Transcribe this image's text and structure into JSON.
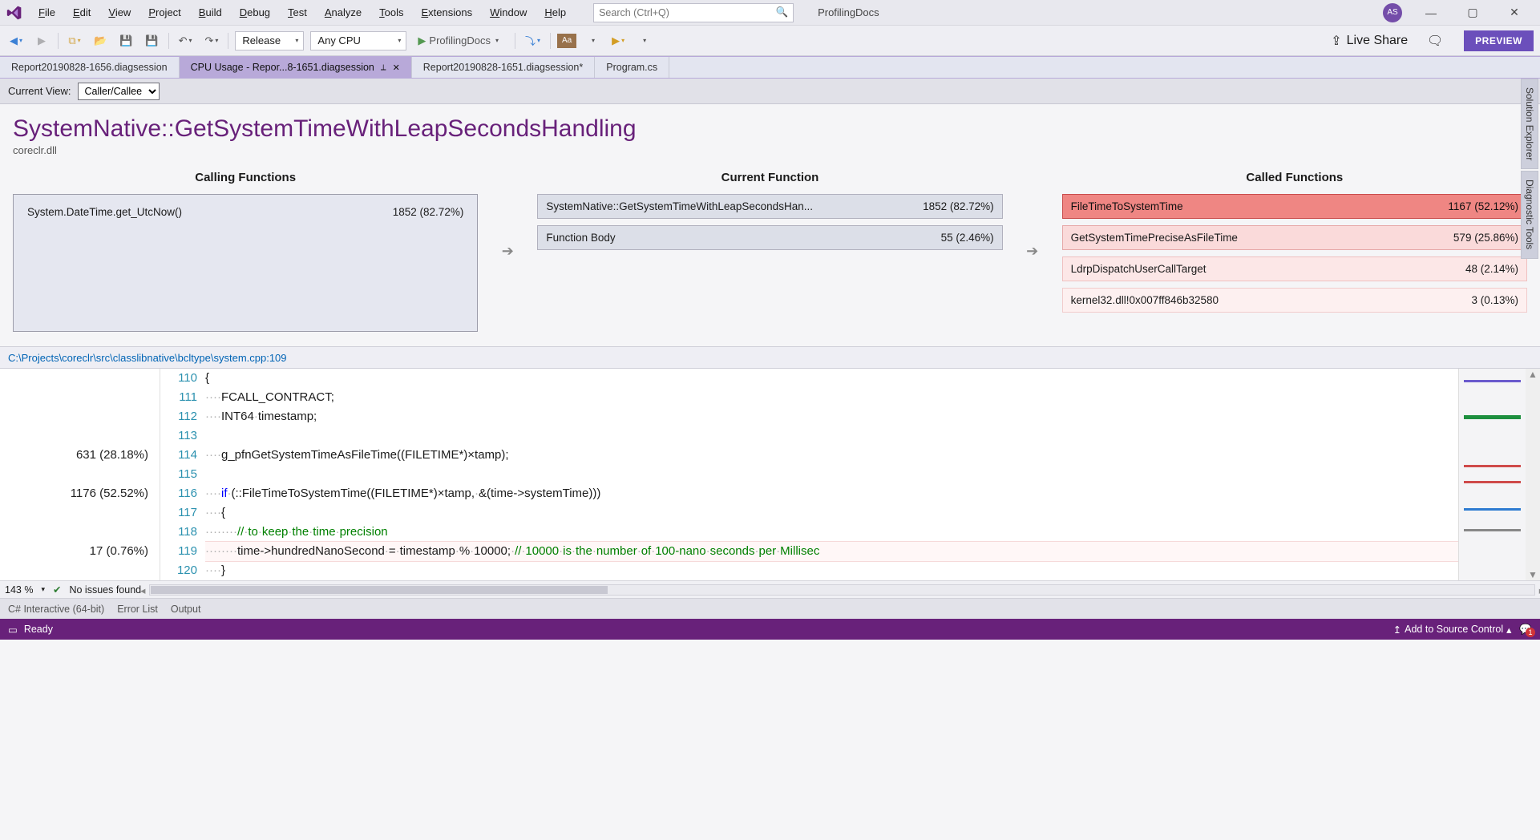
{
  "title_bar": {
    "solution_name": "ProfilingDocs",
    "search_placeholder": "Search (Ctrl+Q)",
    "user_initials": "AS",
    "menus": [
      "File",
      "Edit",
      "View",
      "Project",
      "Build",
      "Debug",
      "Test",
      "Analyze",
      "Tools",
      "Extensions",
      "Window",
      "Help"
    ]
  },
  "toolbar": {
    "config": "Release",
    "platform": "Any CPU",
    "run_target": "ProfilingDocs",
    "live_share": "Live Share",
    "preview": "PREVIEW"
  },
  "doc_tabs": [
    {
      "label": "Report20190828-1656.diagsession",
      "active": false
    },
    {
      "label": "CPU Usage - Repor...8-1651.diagsession",
      "active": true,
      "pinned": true,
      "close": true
    },
    {
      "label": "Report20190828-1651.diagsession*",
      "active": false
    },
    {
      "label": "Program.cs",
      "active": false
    }
  ],
  "side_tabs": [
    "Solution Explorer",
    "Diagnostic Tools"
  ],
  "profiler": {
    "view_label": "Current View:",
    "view_value": "Caller/Callee",
    "function_name": "SystemNative::GetSystemTimeWithLeapSecondsHandling",
    "module": "coreclr.dll",
    "columns": {
      "calling": "Calling Functions",
      "current": "Current Function",
      "called": "Called Functions"
    },
    "calling": [
      {
        "name": "System.DateTime.get_UtcNow()",
        "metric": "1852 (82.72%)"
      }
    ],
    "current_row": {
      "name": "SystemNative::GetSystemTimeWithLeapSecondsHan...",
      "metric": "1852 (82.72%)"
    },
    "body_row": {
      "name": "Function Body",
      "metric": "55 (2.46%)"
    },
    "called": [
      {
        "name": "FileTimeToSystemTime",
        "metric": "1167 (52.12%)",
        "heat": 0
      },
      {
        "name": "GetSystemTimePreciseAsFileTime",
        "metric": "579 (25.86%)",
        "heat": 1
      },
      {
        "name": "LdrpDispatchUserCallTarget",
        "metric": "48 (2.14%)",
        "heat": 2
      },
      {
        "name": "kernel32.dll!0x007ff846b32580",
        "metric": "3 (0.13%)",
        "heat": 3
      }
    ]
  },
  "source": {
    "path": "C:\\Projects\\coreclr\\src\\classlibnative\\bcltype\\system.cpp:109",
    "rows": [
      {
        "ln": "110",
        "metric": "",
        "code": "{"
      },
      {
        "ln": "111",
        "metric": "",
        "code": "····FCALL_CONTRACT;"
      },
      {
        "ln": "112",
        "metric": "",
        "code": "····INT64·timestamp;"
      },
      {
        "ln": "113",
        "metric": "",
        "code": ""
      },
      {
        "ln": "114",
        "metric": "631 (28.18%)",
        "code": "····g_pfnGetSystemTimeAsFileTime((FILETIME*)&timestamp);",
        "hilite": "a"
      },
      {
        "ln": "115",
        "metric": "",
        "code": ""
      },
      {
        "ln": "116",
        "metric": "1176 (52.52%)",
        "code": "····if·(::FileTimeToSystemTime((FILETIME*)&timestamp,·&(time->systemTime)))",
        "hilite": "b"
      },
      {
        "ln": "117",
        "metric": "",
        "code": "····{"
      },
      {
        "ln": "118",
        "metric": "",
        "code": "········//·to·keep·the·time·precision",
        "green": true
      },
      {
        "ln": "119",
        "metric": "17 (0.76%)",
        "code": "········time->hundredNanoSecond·=·timestamp·%·10000;·//·10000·is·the·number·of·100-nano·seconds·per·Millisec",
        "hilite": "c"
      },
      {
        "ln": "120",
        "metric": "",
        "code": "····}"
      }
    ],
    "zoom": "143 %",
    "issues": "No issues found"
  },
  "bottom_tabs": [
    "C# Interactive (64-bit)",
    "Error List",
    "Output"
  ],
  "status": {
    "ready": "Ready",
    "scc": "Add to Source Control",
    "notif_count": "1"
  }
}
